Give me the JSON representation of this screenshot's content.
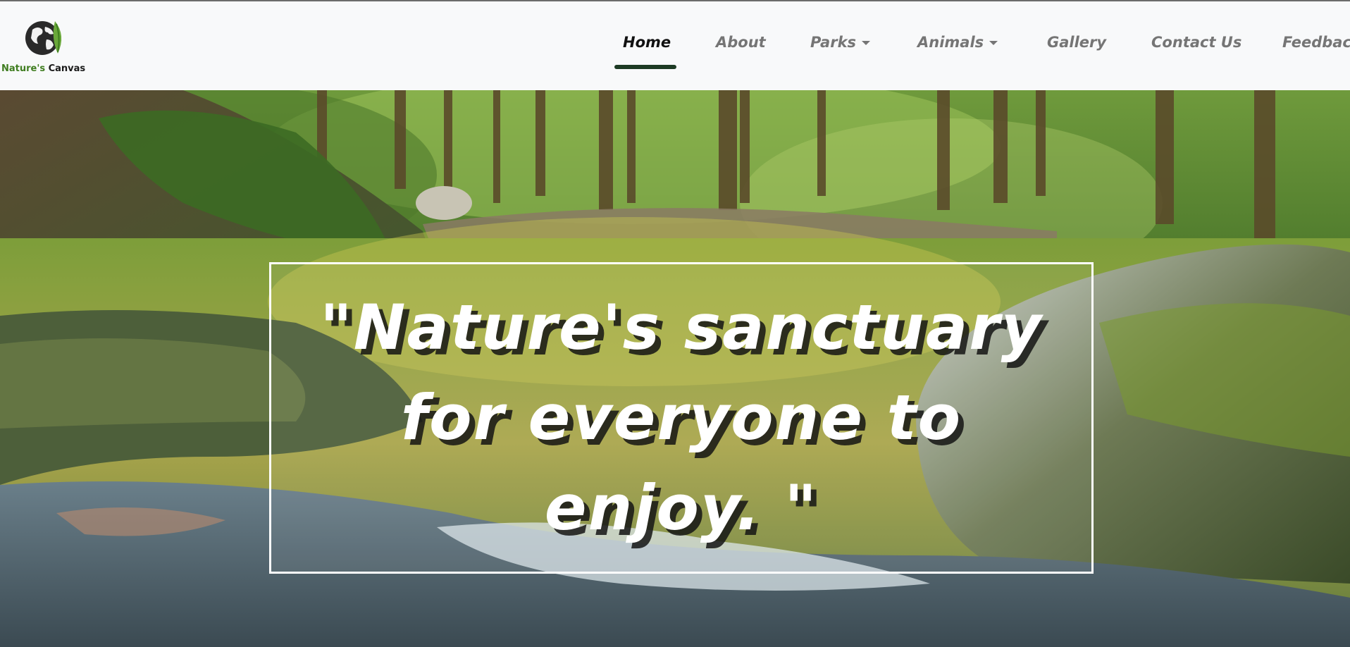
{
  "brand": {
    "name_part1": "Nature's",
    "name_part2": "Canvas"
  },
  "nav": {
    "items": [
      {
        "label": "Home",
        "active": true,
        "dropdown": false
      },
      {
        "label": "About",
        "active": false,
        "dropdown": false
      },
      {
        "label": "Parks",
        "active": false,
        "dropdown": true
      },
      {
        "label": "Animals",
        "active": false,
        "dropdown": true
      },
      {
        "label": "Gallery",
        "active": false,
        "dropdown": false
      },
      {
        "label": "Contact Us",
        "active": false,
        "dropdown": false
      },
      {
        "label": "Feedback",
        "active": false,
        "dropdown": false
      }
    ]
  },
  "hero": {
    "quote": "\"Nature's sanctuary for everyone to enjoy. \""
  },
  "colors": {
    "navbar_bg": "#f8f9fa",
    "active_underline": "#1d3b24",
    "nav_text": "#757575",
    "nav_active_text": "#111111",
    "brand_green": "#3f7d20"
  },
  "icons": {
    "logo": "globe-leaf-icon",
    "dropdown": "caret-down-icon"
  }
}
